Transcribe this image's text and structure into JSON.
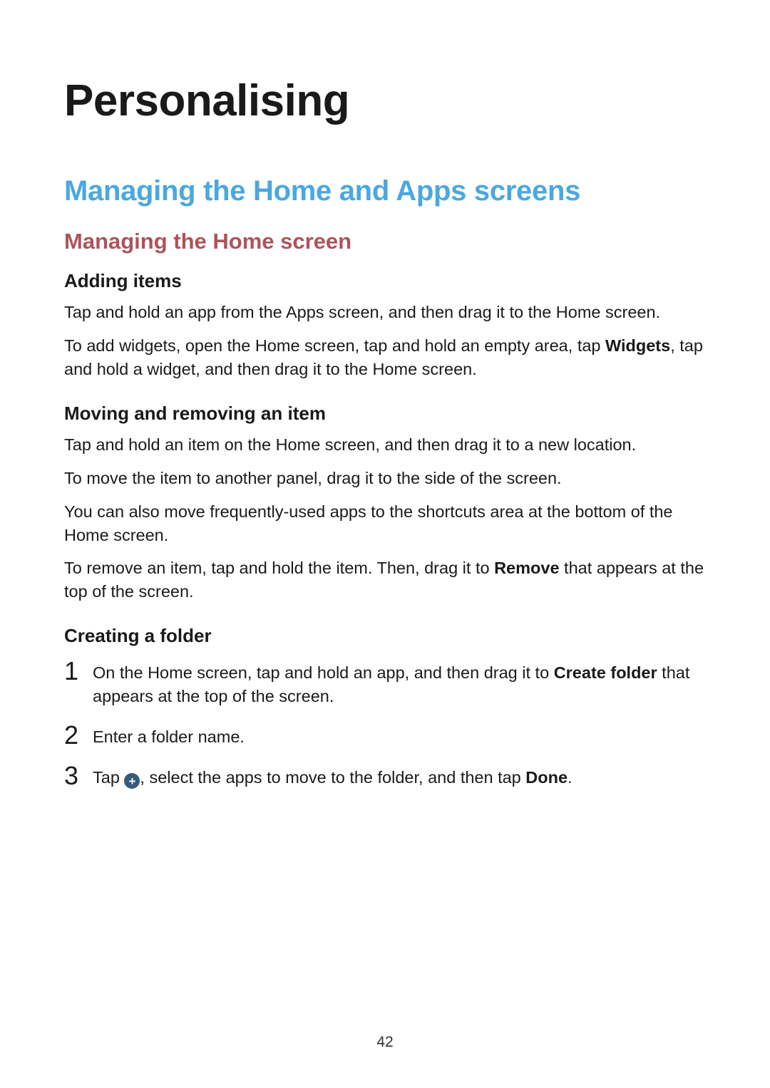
{
  "page": {
    "title": "Personalising",
    "section_title": "Managing the Home and Apps screens",
    "subsection_title": "Managing the Home screen",
    "number": "42"
  },
  "adding": {
    "heading": "Adding items",
    "p1": "Tap and hold an app from the Apps screen, and then drag it to the Home screen.",
    "p2a": "To add widgets, open the Home screen, tap and hold an empty area, tap ",
    "p2_bold": "Widgets",
    "p2b": ", tap and hold a widget, and then drag it to the Home screen."
  },
  "moving": {
    "heading": "Moving and removing an item",
    "p1": "Tap and hold an item on the Home screen, and then drag it to a new location.",
    "p2": "To move the item to another panel, drag it to the side of the screen.",
    "p3": "You can also move frequently-used apps to the shortcuts area at the bottom of the Home screen.",
    "p4a": "To remove an item, tap and hold the item. Then, drag it to ",
    "p4_bold": "Remove",
    "p4b": " that appears at the top of the screen."
  },
  "folder": {
    "heading": "Creating a folder",
    "steps": {
      "n1": "1",
      "s1a": "On the Home screen, tap and hold an app, and then drag it to ",
      "s1_bold": "Create folder",
      "s1b": " that appears at the top of the screen.",
      "n2": "2",
      "s2": "Enter a folder name.",
      "n3": "3",
      "s3a": "Tap ",
      "s3_icon": "+",
      "s3b": ", select the apps to move to the folder, and then tap ",
      "s3_bold": "Done",
      "s3c": "."
    }
  }
}
